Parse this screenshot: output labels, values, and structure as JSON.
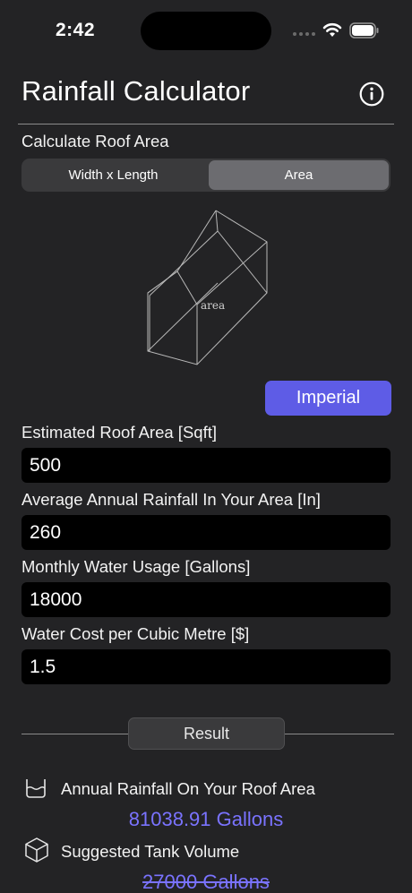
{
  "status": {
    "time": "2:42"
  },
  "header": {
    "title": "Rainfall Calculator",
    "info_icon": "info-circle-icon"
  },
  "roof_area": {
    "section_label": "Calculate Roof Area",
    "segments": [
      {
        "label": "Width x Length",
        "selected": false
      },
      {
        "label": "Area",
        "selected": true
      }
    ],
    "diagram_label": "area"
  },
  "units_button": {
    "label": "Imperial"
  },
  "fields": [
    {
      "label": "Estimated Roof Area [Sqft]",
      "value": "500"
    },
    {
      "label": "Average Annual Rainfall In Your Area [In]",
      "value": "260"
    },
    {
      "label": "Monthly Water Usage [Gallons]",
      "value": "18000"
    },
    {
      "label": "Water Cost per Cubic Metre [$]",
      "value": "1.5"
    }
  ],
  "result": {
    "button_label": "Result",
    "rows": [
      {
        "icon": "water-tank-icon",
        "label": "Annual Rainfall On Your Roof Area",
        "value": "81038.91 Gallons"
      },
      {
        "icon": "cube-icon",
        "label": "Suggested Tank Volume",
        "value": "27000 Gallons"
      }
    ]
  },
  "colors": {
    "background": "#232325",
    "accent": "#5e5ce6",
    "result_text": "#7a73ff"
  }
}
